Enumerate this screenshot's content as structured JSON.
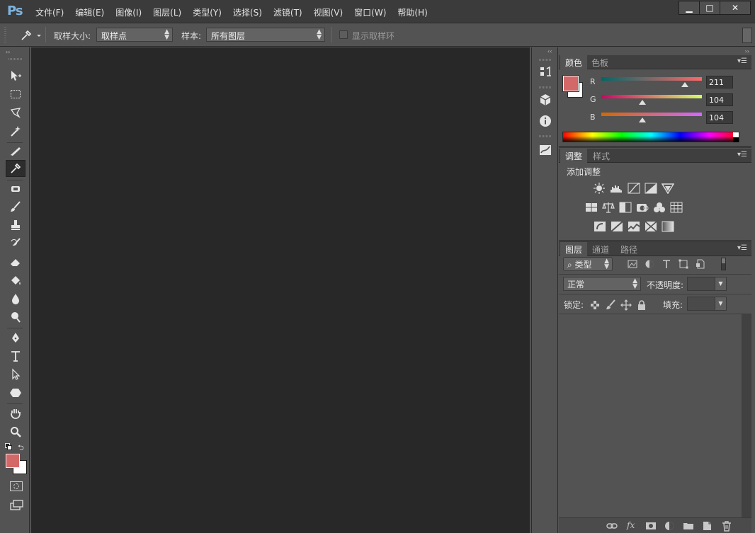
{
  "app": {
    "logo_text": "Ps",
    "window_controls": {
      "minimize": "▁",
      "maximize": "□",
      "close": "✕"
    }
  },
  "menu": {
    "items": [
      "文件(F)",
      "编辑(E)",
      "图像(I)",
      "图层(L)",
      "类型(Y)",
      "选择(S)",
      "滤镜(T)",
      "视图(V)",
      "窗口(W)",
      "帮助(H)"
    ]
  },
  "options_bar": {
    "sample_size_label": "取样大小:",
    "sample_size_value": "取样点",
    "sample_label": "样本:",
    "sample_value": "所有图层",
    "show_ring_label": "显示取样环"
  },
  "panels": {
    "color": {
      "tabs": [
        "颜色",
        "色板"
      ],
      "channels": [
        {
          "label": "R",
          "value": "211",
          "level": 0.83
        },
        {
          "label": "G",
          "value": "104",
          "level": 0.41
        },
        {
          "label": "B",
          "value": "104",
          "level": 0.41
        }
      ],
      "foreground": "#d36868",
      "background": "#ffffff"
    },
    "adjustments": {
      "tabs": [
        "调整",
        "样式"
      ],
      "heading": "添加调整"
    },
    "layers": {
      "tabs": [
        "图层",
        "通道",
        "路径"
      ],
      "filter_kind": "类型",
      "blend_mode": "正常",
      "opacity_label": "不透明度:",
      "lock_label": "锁定:",
      "fill_label": "填充:"
    }
  },
  "colors": {
    "menubar_bg": "#3b3b3b",
    "panel_bg": "#535353",
    "canvas_bg": "#282828",
    "foreground_swatch": "#d36868"
  }
}
